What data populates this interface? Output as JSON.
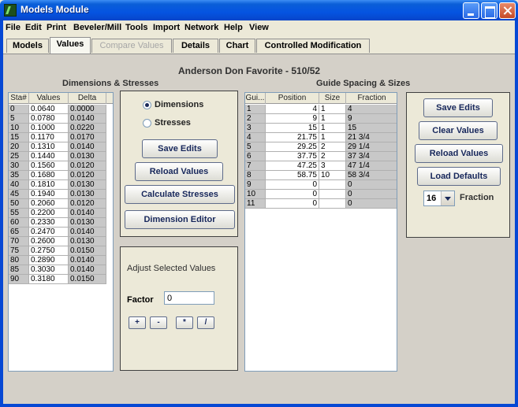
{
  "window": {
    "title": "Models Module"
  },
  "menu": [
    "File",
    "Edit",
    "Print",
    "Beveler/Mill",
    "Tools",
    "Import",
    "Network",
    "Help",
    "View"
  ],
  "tabs": [
    {
      "label": "Models",
      "state": "normal"
    },
    {
      "label": "Values",
      "state": "active"
    },
    {
      "label": "Compare Values",
      "state": "disabled"
    },
    {
      "label": "Details",
      "state": "normal"
    },
    {
      "label": "Chart",
      "state": "normal"
    },
    {
      "label": "Controlled Modification",
      "state": "normal"
    }
  ],
  "model_title": "Anderson Don Favorite - 510/52",
  "dims": {
    "heading": "Dimensions & Stresses",
    "columns": [
      "Sta#",
      "Values",
      "Delta"
    ],
    "rows": [
      [
        "0",
        "0.0640",
        "0.0000"
      ],
      [
        "5",
        "0.0780",
        "0.0140"
      ],
      [
        "10",
        "0.1000",
        "0.0220"
      ],
      [
        "15",
        "0.1170",
        "0.0170"
      ],
      [
        "20",
        "0.1310",
        "0.0140"
      ],
      [
        "25",
        "0.1440",
        "0.0130"
      ],
      [
        "30",
        "0.1560",
        "0.0120"
      ],
      [
        "35",
        "0.1680",
        "0.0120"
      ],
      [
        "40",
        "0.1810",
        "0.0130"
      ],
      [
        "45",
        "0.1940",
        "0.0130"
      ],
      [
        "50",
        "0.2060",
        "0.0120"
      ],
      [
        "55",
        "0.2200",
        "0.0140"
      ],
      [
        "60",
        "0.2330",
        "0.0130"
      ],
      [
        "65",
        "0.2470",
        "0.0140"
      ],
      [
        "70",
        "0.2600",
        "0.0130"
      ],
      [
        "75",
        "0.2750",
        "0.0150"
      ],
      [
        "80",
        "0.2890",
        "0.0140"
      ],
      [
        "85",
        "0.3030",
        "0.0140"
      ],
      [
        "90",
        "0.3180",
        "0.0150"
      ]
    ]
  },
  "options": {
    "radio_dimensions": "Dimensions",
    "radio_stresses": "Stresses",
    "selected": "Dimensions",
    "save_edits": "Save Edits",
    "reload_values": "Reload Values",
    "calculate_stresses": "Calculate Stresses",
    "dimension_editor": "Dimension Editor"
  },
  "adjust": {
    "label": "Adjust Selected Values",
    "factor_label": "Factor",
    "factor_value": "0",
    "ops": [
      "+",
      "-",
      "*",
      "/"
    ]
  },
  "guides": {
    "heading": "Guide Spacing & Sizes",
    "columns": [
      "Gui...",
      "Position",
      "Size",
      "Fraction"
    ],
    "rows": [
      [
        "1",
        "4",
        "1",
        "4"
      ],
      [
        "2",
        "9",
        "1",
        "9"
      ],
      [
        "3",
        "15",
        "1",
        "15"
      ],
      [
        "4",
        "21.75",
        "1",
        "21 3/4"
      ],
      [
        "5",
        "29.25",
        "2",
        "29 1/4"
      ],
      [
        "6",
        "37.75",
        "2",
        "37 3/4"
      ],
      [
        "7",
        "47.25",
        "3",
        "47 1/4"
      ],
      [
        "8",
        "58.75",
        "10",
        "58 3/4"
      ],
      [
        "9",
        "0",
        "",
        "0"
      ],
      [
        "10",
        "0",
        "",
        "0"
      ],
      [
        "11",
        "0",
        "",
        "0"
      ]
    ]
  },
  "guide_actions": {
    "save_edits": "Save Edits",
    "clear_values": "Clear Values",
    "reload_values": "Reload Values",
    "load_defaults": "Load Defaults",
    "fraction_value": "16",
    "fraction_label": "Fraction"
  }
}
